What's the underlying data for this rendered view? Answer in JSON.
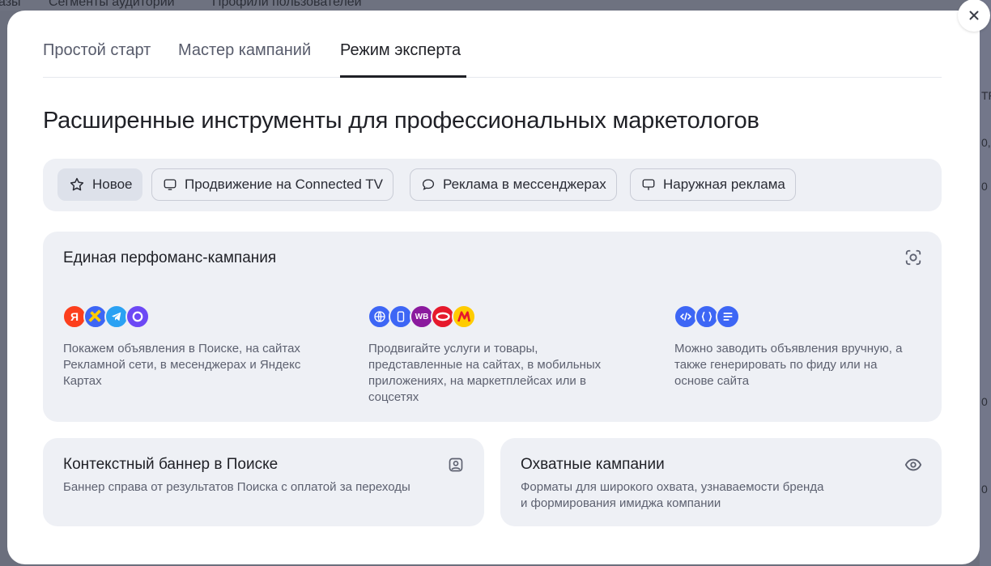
{
  "backdrop": {
    "tabs_hint": [
      "азы",
      "Сегменты аудитории",
      "Профили пользователей"
    ],
    "right_hint": [
      "TR",
      "0,",
      "0",
      "0",
      "0"
    ]
  },
  "modal": {
    "close_label": "Закрыть",
    "tabs": [
      {
        "label": "Простой старт"
      },
      {
        "label": "Мастер кампаний"
      },
      {
        "label": "Режим эксперта"
      }
    ],
    "title": "Расширенные инструменты для профессиональных маркетологов",
    "chips": [
      {
        "label": "Новое",
        "icon": "star-icon"
      },
      {
        "label": "Продвижение на Connected TV",
        "icon": "tv-icon"
      },
      {
        "label": "Реклама в мессенджерах",
        "icon": "chat-bubble-icon"
      },
      {
        "label": "Наружная реклама",
        "icon": "billboard-icon"
      }
    ],
    "performance_card": {
      "title": "Единая перфоманс-кампания",
      "features": [
        {
          "text": "Покажем объявления в Поиске, на сайтах Рекламной сети, в месенджерах и Яндекс Картах"
        },
        {
          "text": "Продвигайте услуги и товары, представленные на сайтах, в мобильных приложениях, на маркетплейсах или в соцсетях"
        },
        {
          "text": "Можно заводить объявления вручную, а также генерировать по фиду или на основе сайта"
        }
      ],
      "badge_texts": {
        "yandex": "Я",
        "wb": "WB"
      }
    },
    "banner_card": {
      "title": "Контекстный баннер в Поиске",
      "subtitle": "Баннер справа от результатов Поиска с оплатой за переходы"
    },
    "reach_card": {
      "title": "Охватные кампании",
      "subtitle_line1": "Форматы для широкого охвата, узнаваемости бренда",
      "subtitle_line2": "и формирования имиджа компании"
    }
  },
  "colors": {
    "card_bg": "#eef0f5",
    "accent_blue": "#3d66f5",
    "text_primary": "#1f2026",
    "text_secondary": "#5d6170"
  }
}
